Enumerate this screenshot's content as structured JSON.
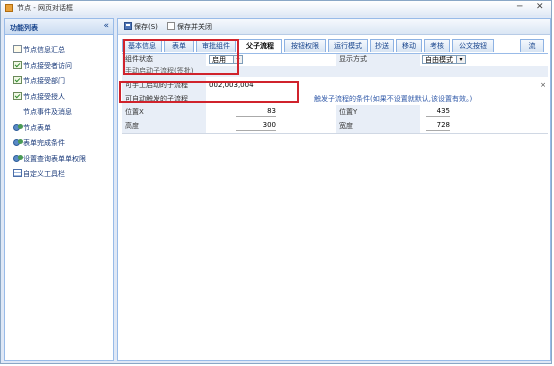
{
  "window": {
    "title": "节点 - 网页对话框",
    "minimize": "─",
    "close": "✕"
  },
  "left": {
    "header": "功能列表",
    "collapse": "«",
    "items": [
      {
        "label": "节点信息汇总",
        "icon": "document-icon"
      },
      {
        "label": "节点接受者访问",
        "icon": "check-icon"
      },
      {
        "label": "节点接受部门",
        "icon": "check-icon"
      },
      {
        "label": "节点接受授人",
        "icon": "check-icon"
      },
      {
        "label": "节点事件及消息",
        "icon": "none"
      },
      {
        "label": "节点表单",
        "icon": "users-icon"
      },
      {
        "label": "表单完成条件",
        "icon": "users-icon"
      },
      {
        "label": "设置查询表单单权限",
        "icon": "users-icon"
      },
      {
        "label": "自定义工具栏",
        "icon": "table-icon"
      }
    ]
  },
  "toolbar": {
    "save": "保存(S)",
    "save_close": "保存并关闭"
  },
  "tabs": [
    {
      "label": "基本信息"
    },
    {
      "label": "表单"
    },
    {
      "label": "审批组件"
    },
    {
      "label": "父子流程"
    },
    {
      "label": "按钮权限"
    },
    {
      "label": "运行模式"
    },
    {
      "label": "抄送"
    },
    {
      "label": "移动"
    },
    {
      "label": "考核"
    },
    {
      "label": "公文按钮"
    },
    {
      "label": "流"
    }
  ],
  "form": {
    "component_state_label": "组件状态",
    "component_state_value": "启用",
    "display_mode_label": "显示方式",
    "display_mode_value": "自由模式",
    "section_label": "手动启动子流程(签批)",
    "manual_label": "可手工启动的子流程",
    "manual_value": "002,003,004",
    "clear": "×",
    "auto_label": "可自动触发的子流程",
    "auto_note": "触发子流程的条件(如果不设置就默认,该设置有效。)",
    "pos_x_label": "位置X",
    "pos_x_value": "83",
    "pos_y_label": "位置Y",
    "pos_y_value": "435",
    "height_label": "高度",
    "height_value": "300",
    "width_label": "宽度",
    "width_value": "728"
  },
  "colors": {
    "highlight": "#d0232c",
    "accent": "#15428b"
  }
}
